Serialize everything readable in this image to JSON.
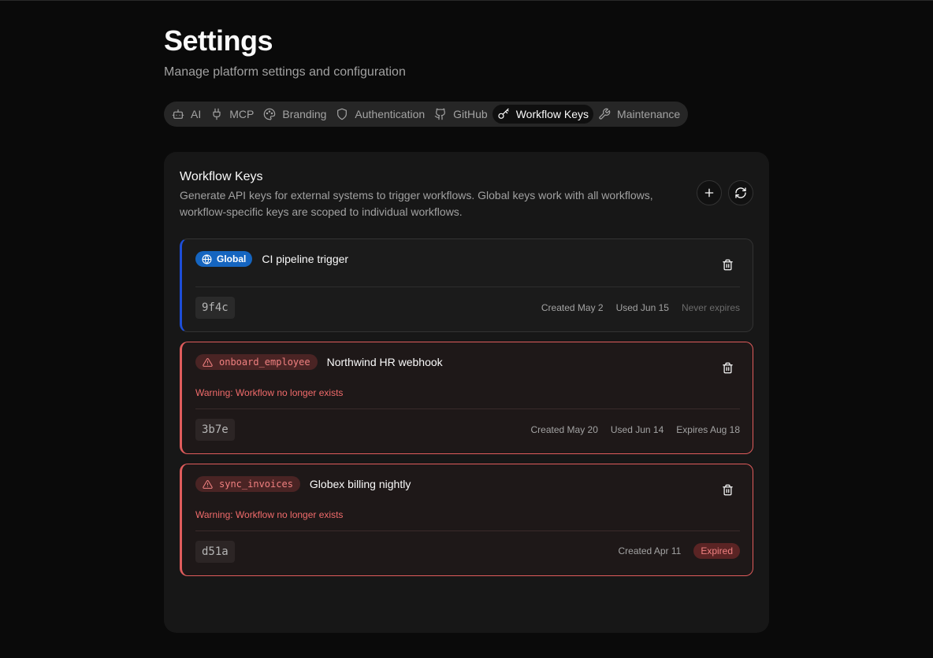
{
  "header": {
    "title": "Settings",
    "subtitle": "Manage platform settings and configuration"
  },
  "tabs": [
    {
      "label": "AI",
      "icon": "bot-icon"
    },
    {
      "label": "MCP",
      "icon": "plug-icon"
    },
    {
      "label": "Branding",
      "icon": "palette-icon"
    },
    {
      "label": "Authentication",
      "icon": "shield-icon"
    },
    {
      "label": "GitHub",
      "icon": "github-icon"
    },
    {
      "label": "Workflow Keys",
      "icon": "key-icon",
      "active": true
    },
    {
      "label": "Maintenance",
      "icon": "wrench-icon"
    }
  ],
  "panel": {
    "title": "Workflow Keys",
    "description": "Generate API keys for external systems to trigger workflows. Global keys work with all workflows, workflow-specific keys are scoped to individual workflows.",
    "add_icon": "plus-icon",
    "refresh_icon": "refresh-icon"
  },
  "keys": [
    {
      "scope_label": "Global",
      "name": "CI pipeline trigger",
      "key_suffix": "9f4c",
      "created": "Created May 2",
      "used": "Used Jun 15",
      "expires": "Never expires"
    },
    {
      "scope_label": "onboard_employee",
      "name": "Northwind HR webhook",
      "warning": "Warning: Workflow no longer exists",
      "key_suffix": "3b7e",
      "created": "Created May 20",
      "used": "Used Jun 14",
      "expires": "Expires Aug 18"
    },
    {
      "scope_label": "sync_invoices",
      "name": "Globex billing nightly",
      "warning": "Warning: Workflow no longer exists",
      "key_suffix": "d51a",
      "created": "Created Apr 11",
      "status": "Expired"
    }
  ],
  "colors": {
    "background": "#0a0a0a",
    "panel": "#171717",
    "global_accent": "#1565c0",
    "warning_accent": "#e05c5c"
  }
}
